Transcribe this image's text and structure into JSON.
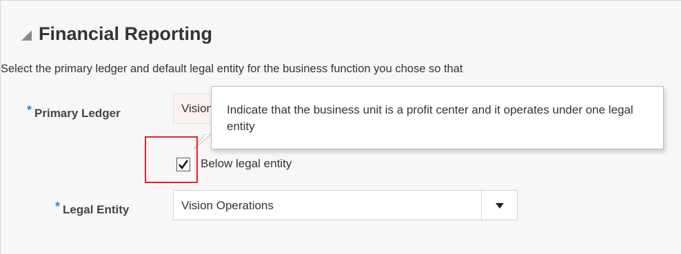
{
  "section": {
    "title": "Financial Reporting",
    "instruction": "Select the primary ledger and default legal entity for the business function you chose so that"
  },
  "primary_ledger": {
    "required_marker": "*",
    "label": "Primary Ledger",
    "value": "Vision"
  },
  "note_window": {
    "text": "Indicate that the business unit is a profit center and it operates under one legal entity"
  },
  "below_legal_entity": {
    "label": "Below legal entity",
    "checked": true
  },
  "legal_entity": {
    "required_marker": "*",
    "label": "Legal Entity",
    "value": "Vision Operations"
  },
  "colors": {
    "required_marker": "#1f8ed6",
    "highlight": "#e0232b",
    "panel_background": "#f7f7f7",
    "primary_input_background": "#fcf1ee"
  },
  "icons": {
    "collapse": "triangle-collapse-icon",
    "checkbox": "checkmark-icon",
    "dropdown": "chevron-down-icon"
  }
}
